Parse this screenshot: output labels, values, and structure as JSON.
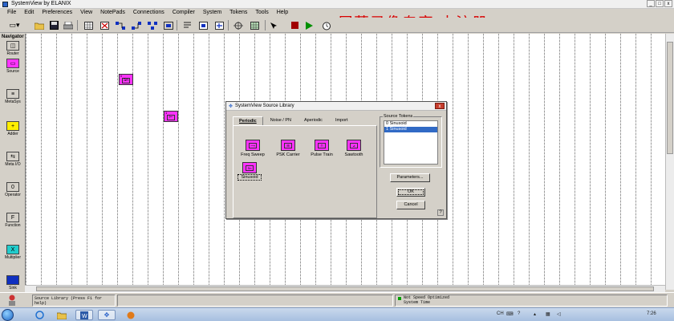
{
  "window": {
    "title": "SystemView by ELANIX",
    "minimize": "_",
    "maximize": "□",
    "close": "x"
  },
  "menu": [
    "File",
    "Edit",
    "Preferences",
    "View",
    "NotePads",
    "Connections",
    "Compiler",
    "System",
    "Tokens",
    "Tools",
    "Help"
  ],
  "watermark": "屏幕录像专家  未注册",
  "toolbar_icons": [
    "dropdown-icon",
    "open-folder-icon",
    "save-icon",
    "print-icon",
    "table-icon",
    "delete-icon",
    "connect-icon",
    "disconnect-icon",
    "group-icon",
    "ungroup-icon",
    "list-icon",
    "notepad-icon",
    "meta-icon",
    "zoom-icon",
    "calc-icon",
    "stop-icon",
    "run-icon",
    "timer-icon",
    "help-arrow-icon"
  ],
  "navigator": {
    "title": "Navigator",
    "items": [
      {
        "label": "Router",
        "glyph": "◫",
        "color": "#d4d0c8"
      },
      {
        "label": "Source",
        "glyph": "▭",
        "color": "#ff33ff"
      },
      {
        "label": "MetaSys",
        "glyph": "≡",
        "color": "#d4d0c8"
      },
      {
        "label": "Adder",
        "glyph": "+",
        "color": "#ffee00"
      },
      {
        "label": "Meta I/O",
        "glyph": "⇆",
        "color": "#d4d0c8"
      },
      {
        "label": "Operator",
        "glyph": "0",
        "color": "#d4d0c8"
      },
      {
        "label": "Function",
        "glyph": "F",
        "color": "#d4d0c8"
      },
      {
        "label": "Multiplier",
        "glyph": "X",
        "color": "#22cccc"
      },
      {
        "label": "Sink",
        "glyph": "",
        "color": "#1030c0"
      }
    ]
  },
  "canvas_tokens": [
    {
      "num": "0",
      "glyph": "Sn"
    },
    {
      "num": "1",
      "glyph": "⊢"
    }
  ],
  "dialog": {
    "title": "SystemView Source Library",
    "close": "x",
    "tabs": [
      "Periodic",
      "Noise / PN",
      "Aperiodic",
      "Import"
    ],
    "active_tab": "Periodic",
    "library_tokens": [
      {
        "label": "Freq Sweep",
        "glyph": "⟿"
      },
      {
        "label": "PSK Carrier",
        "glyph": "⊞"
      },
      {
        "label": "Pulse Train",
        "glyph": "⊓"
      },
      {
        "label": "Sawtooth",
        "glyph": "⊿"
      },
      {
        "label": "Sinusoid",
        "glyph": "Sn"
      }
    ],
    "source_tokens": {
      "title": "Source Tokens",
      "items": [
        "0  Sinusoid",
        "1  Sinusoid"
      ],
      "selected_index": 1
    },
    "buttons": {
      "parameters": "Parameters...",
      "ok": "OK",
      "cancel": "Cancel",
      "help": "?"
    }
  },
  "status": {
    "message": "Source Library (Press F1 for help)",
    "flags": [
      "Not Speed Optimized",
      "System Time"
    ]
  },
  "taskbar": {
    "lang": "CH",
    "clock": "7:26"
  }
}
